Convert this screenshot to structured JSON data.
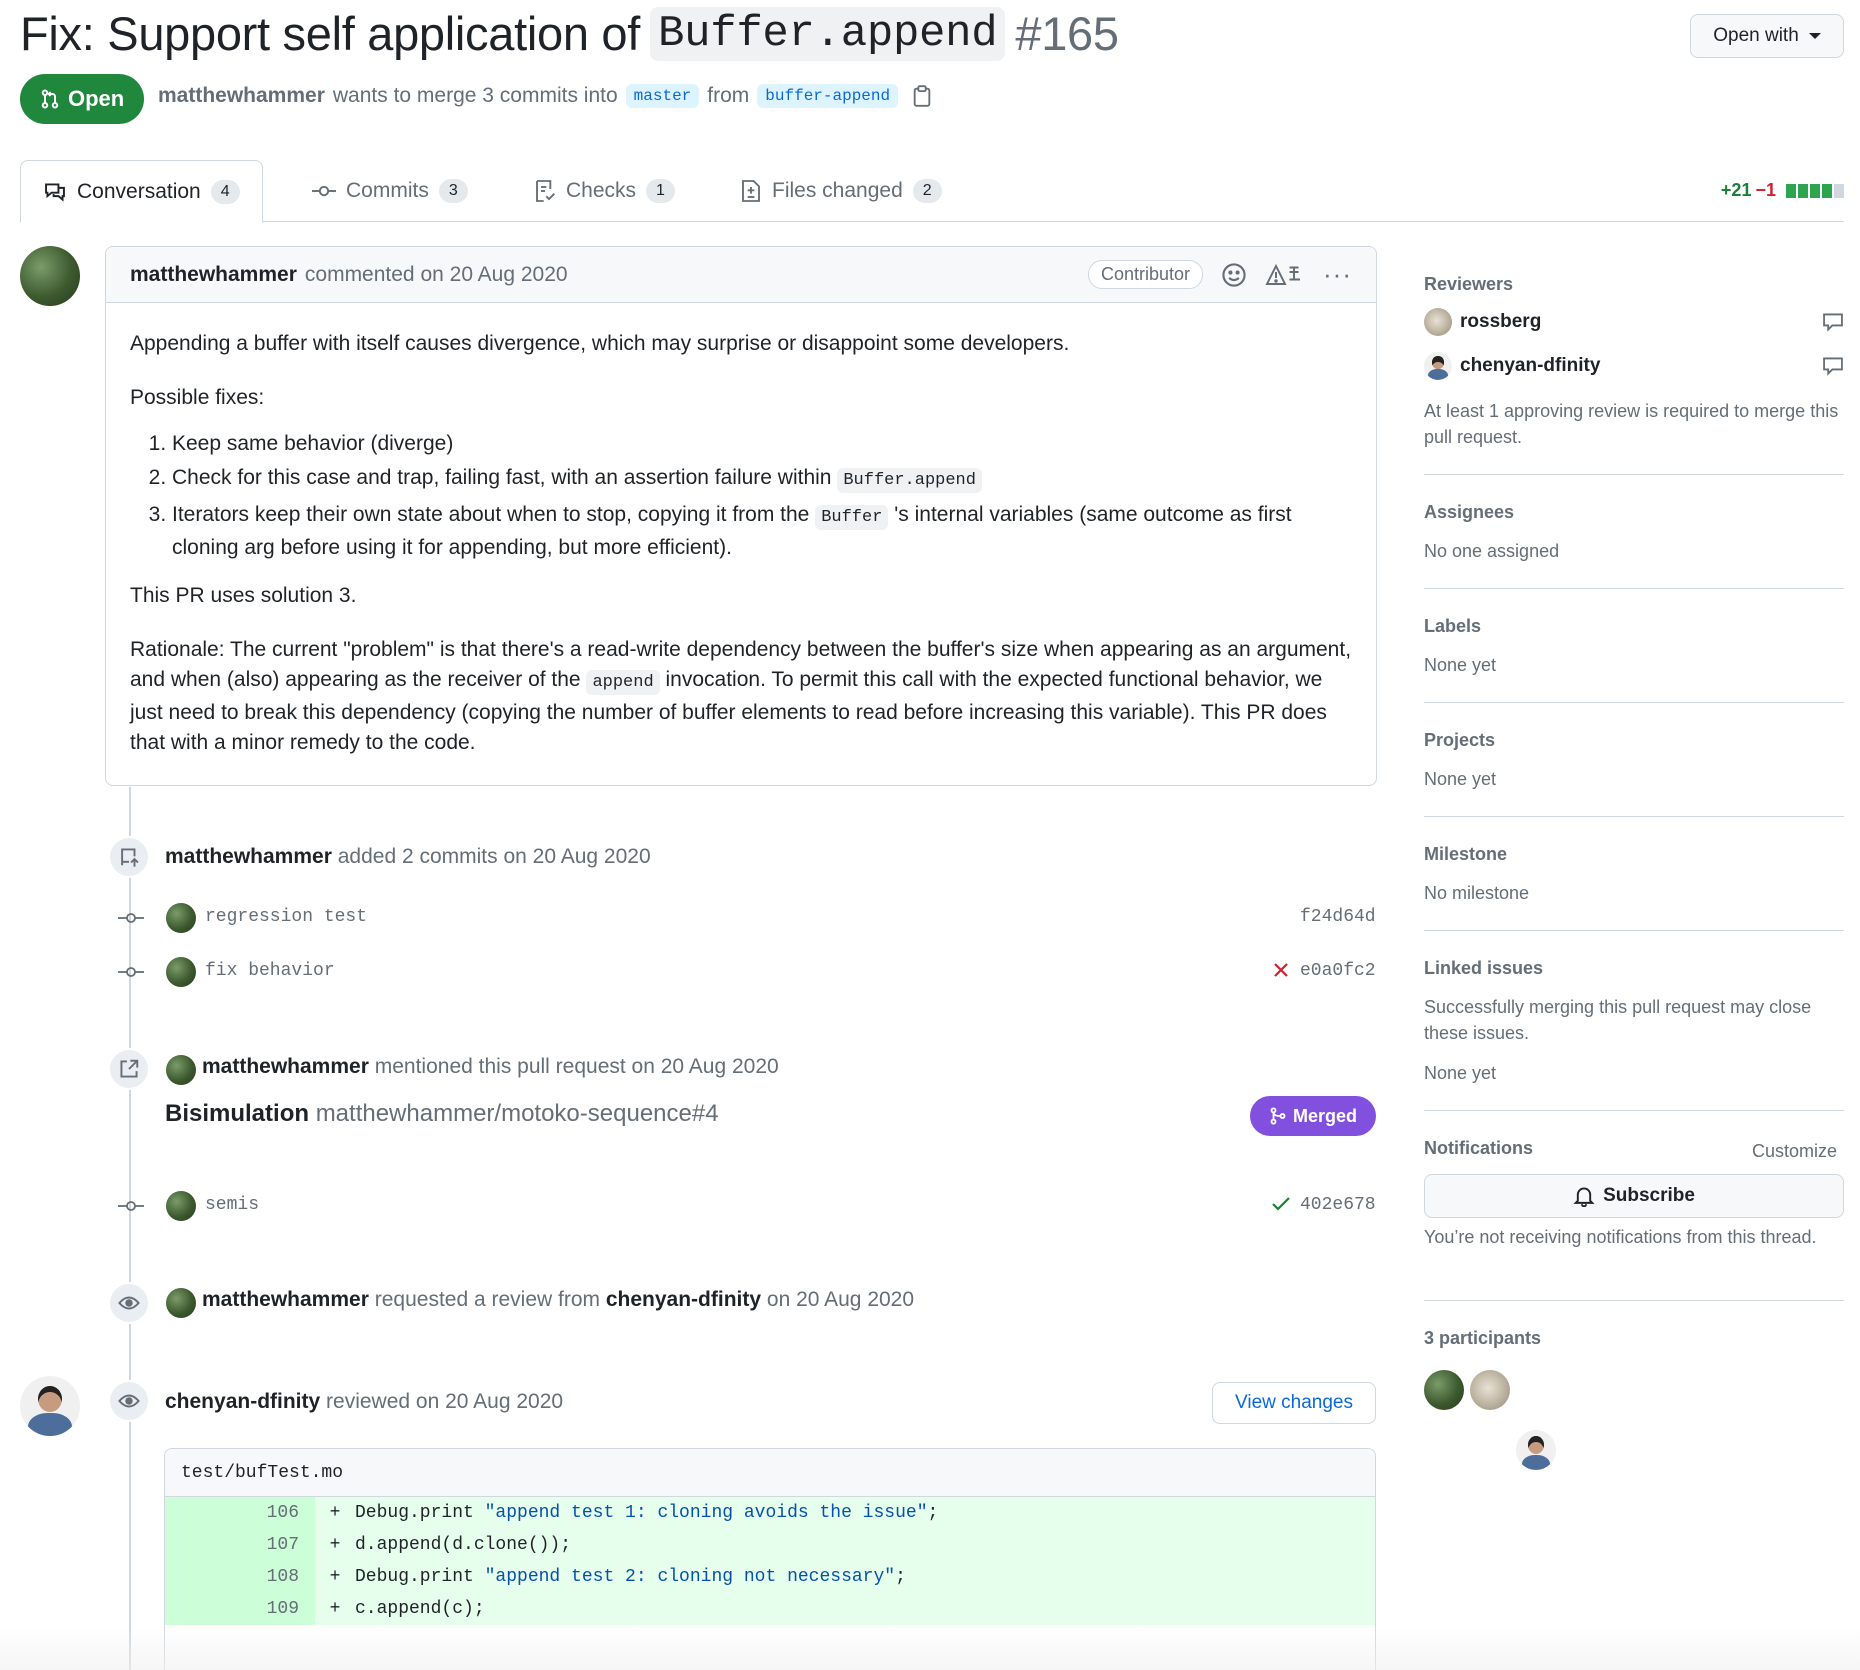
{
  "header": {
    "title_prefix": "Fix: Support self application of",
    "title_code": "Buffer.append",
    "number": "#165",
    "open_with": "Open with",
    "state": "Open",
    "author": "matthewhammer",
    "merge_text": "wants to merge 3 commits into",
    "base_branch": "master",
    "from_text": "from",
    "head_branch": "buffer-append"
  },
  "tabs": [
    {
      "label": "Conversation",
      "count": "4"
    },
    {
      "label": "Commits",
      "count": "3"
    },
    {
      "label": "Checks",
      "count": "1"
    },
    {
      "label": "Files changed",
      "count": "2"
    }
  ],
  "diffstat": {
    "additions": "+21",
    "deletions": "−1"
  },
  "comment": {
    "author": "matthewhammer",
    "action": "commented on 20 Aug 2020",
    "badge": "Contributor",
    "p1": "Appending a buffer with itself causes divergence, which may surprise or disappoint some developers.",
    "p2": "Possible fixes:",
    "li1": "Keep same behavior (diverge)",
    "li2_text": "Check for this case and trap, failing fast, with an assertion failure within",
    "li2_code": "Buffer.append",
    "li3_a": "Iterators keep their own state about when to stop, copying it from the",
    "li3_code": "Buffer",
    "li3_b": "'s internal variables (same outcome as first cloning arg before using it for appending, but more efficient).",
    "p3": "This PR uses solution 3.",
    "p4_a": "Rationale: The current \"problem\" is that there's a read-write dependency between the buffer's size when appearing as an argument, and when (also) appearing as the receiver of the",
    "p4_code": "append",
    "p4_b": "invocation. To permit this call with the expected functional behavior, we just need to break this dependency (copying the number of buffer elements to read before increasing this variable). This PR does that with a minor remedy to the code."
  },
  "timeline": {
    "commits_event": {
      "author": "matthewhammer",
      "text": "added 2 commits on 20 Aug 2020"
    },
    "commits": [
      {
        "message": "regression test",
        "sha": "f24d64d"
      },
      {
        "message": "fix behavior",
        "sha": "e0a0fc2"
      }
    ],
    "mention": {
      "author": "matthewhammer",
      "text": "mentioned this pull request on 20 Aug 2020",
      "ref_title": "Bisimulation",
      "ref_repo": "matthewhammer/motoko-sequence#4",
      "status": "Merged"
    },
    "commit3": {
      "message": "semis",
      "sha": "402e678"
    },
    "review_request": {
      "author": "matthewhammer",
      "text": "requested a review from",
      "reviewer": "chenyan-dfinity",
      "date": "on 20 Aug 2020"
    },
    "review": {
      "author": "chenyan-dfinity",
      "text": "reviewed on 20 Aug 2020",
      "button": "View changes"
    },
    "code": {
      "file": "test/bufTest.mo",
      "lines": [
        {
          "num": "106",
          "sign": "+",
          "pre": "Debug.print ",
          "str": "\"append test 1: cloning avoids the issue\"",
          "post": ";"
        },
        {
          "num": "107",
          "sign": "+",
          "pre": "d.append(d.clone());",
          "str": "",
          "post": ""
        },
        {
          "num": "108",
          "sign": "+",
          "pre": "Debug.print ",
          "str": "\"append test 2: cloning not necessary\"",
          "post": ";"
        },
        {
          "num": "109",
          "sign": "+",
          "pre": "c.append(c);",
          "str": "",
          "post": ""
        }
      ]
    }
  },
  "sidebar": {
    "reviewers_title": "Reviewers",
    "reviewers": [
      "rossberg",
      "chenyan-dfinity"
    ],
    "reviewers_note": "At least 1 approving review is required to merge this pull request.",
    "assignees_title": "Assignees",
    "assignees_value": "No one assigned",
    "labels_title": "Labels",
    "labels_value": "None yet",
    "projects_title": "Projects",
    "projects_value": "None yet",
    "milestone_title": "Milestone",
    "milestone_value": "No milestone",
    "linked_title": "Linked issues",
    "linked_note": "Successfully merging this pull request may close these issues.",
    "linked_value": "None yet",
    "notifications_title": "Notifications",
    "customize": "Customize",
    "subscribe": "Subscribe",
    "notifications_note": "You’re not receiving notifications from this thread.",
    "participants": "3 participants"
  }
}
